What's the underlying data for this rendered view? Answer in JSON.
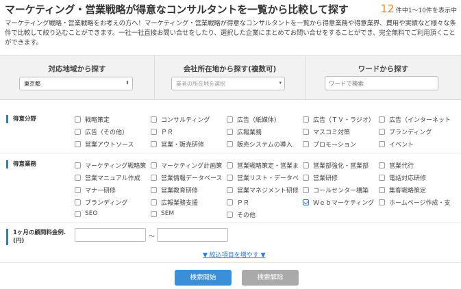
{
  "header": {
    "title": "マーケティング・営業戦略が得意なコンサルタントを一覧から比較して探す",
    "count_num": "12",
    "count_text": "件中1〜10件を表示中",
    "description": "マーケティング戦略・営業戦略をお考えの方へ！マーケティング・営業戦略が得意なコンサルタントを一覧から得意業務や得意業界、費用や実績など様々な条件で比較して絞り込むことができます。一社一社直接お問い合せをしたり、選択した企業にまとめてお問い合せをすることができ、完全無料でご利用頂くことができます。"
  },
  "search": {
    "region_title": "対応地域から探す",
    "region_value": "東京都",
    "location_title": "会社所在地から探す(複数可)",
    "location_placeholder": "業者の所在地を選択",
    "word_title": "ワードから探す",
    "word_placeholder": "ワードで検索"
  },
  "fields": {
    "field_label": "得意分野",
    "field_items": [
      "戦略策定",
      "コンサルティング",
      "広告（紙媒体）",
      "広告（ＴＶ・ラジオ）",
      "広告（インターネット",
      "広告（その他）",
      "ＰＲ",
      "広報業務",
      "マスコミ対策",
      "ブランディング",
      "営業アウトソース",
      "営業・販売研修",
      "販売システムの導入",
      "プロモーション",
      "イベント"
    ],
    "work_label": "得意業務",
    "work_items": [
      "マーケティング戦略策",
      "マーケティング計画策",
      "営業戦略策定・営業ま",
      "営業部強化・営業部",
      "営業代行",
      "営業マニュアル作成",
      "営業情報データベース",
      "営業リスト・データベ",
      "営業研修",
      "電話対応研修",
      "マナー研修",
      "営業教育研修",
      "営業マネジメント研修",
      "コールセンター構築",
      "集客戦略策定",
      "ブランディング",
      "広報業務支援",
      "ＰＲ",
      "Ｗｅｂマーケティング",
      "ホームページ作成・支",
      "SEO",
      "SEM",
      "その他"
    ],
    "work_checked_index": 18,
    "fee_label_1": "1ヶ月の顧問料金例.",
    "fee_label_2": "(円)",
    "tilde": "〜",
    "more_link": "▼ 絞込項目を増やす ▼"
  },
  "buttons": {
    "search": "検索開始",
    "clear": "検索解除"
  },
  "colors": {
    "accent": "#2b7ad1",
    "count": "#f08c1e",
    "search_button": "#3a8fd6",
    "clear_button": "#aaaaaa"
  }
}
